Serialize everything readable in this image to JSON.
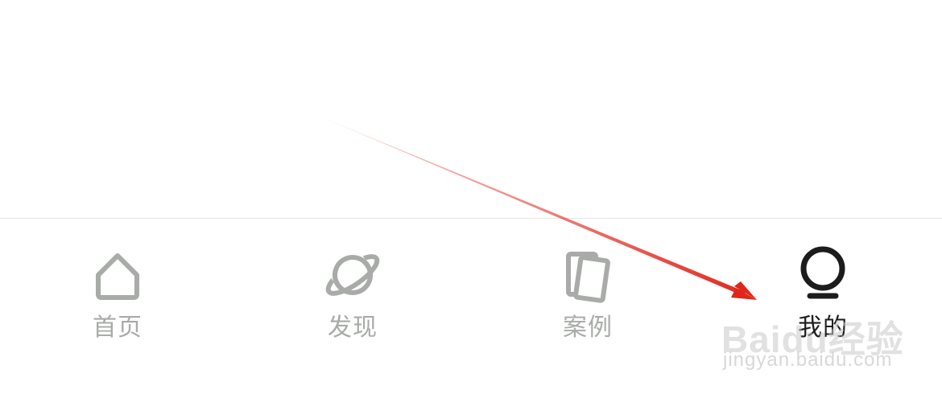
{
  "tabbar": {
    "active_tab": "mine",
    "inactive_color": "#a8aba8",
    "active_color": "#1c1c1c",
    "tabs": [
      {
        "id": "home",
        "label": "首页",
        "icon": "home-icon"
      },
      {
        "id": "discover",
        "label": "发现",
        "icon": "planet-icon"
      },
      {
        "id": "cases",
        "label": "案例",
        "icon": "cards-icon"
      },
      {
        "id": "mine",
        "label": "我的",
        "icon": "profile-icon"
      }
    ]
  },
  "annotation": {
    "arrow_color": "#e0261b",
    "points_to": "mine"
  },
  "watermark": {
    "brand": "Baidu经验",
    "url": "jingyan.baidu.com"
  }
}
